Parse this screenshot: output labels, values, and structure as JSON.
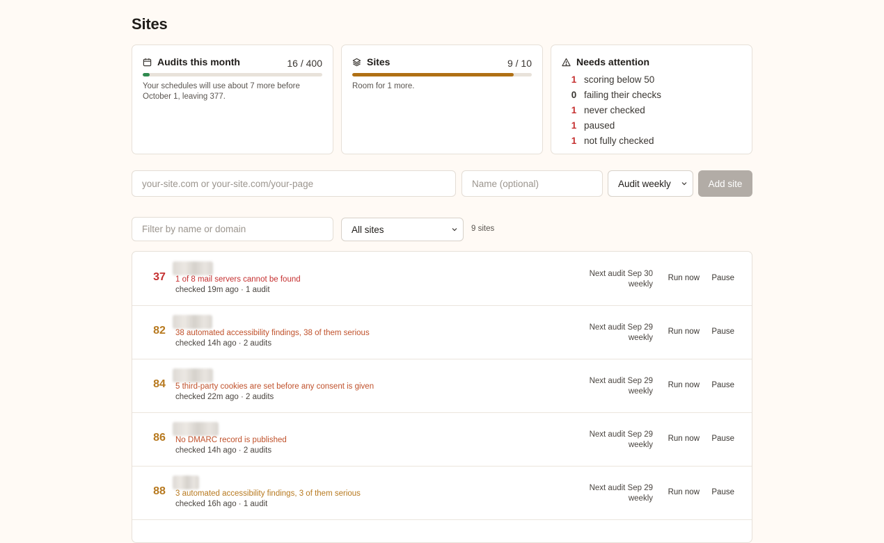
{
  "page": {
    "title": "Sites"
  },
  "cards": {
    "audits": {
      "icon": "calendar-icon",
      "title": "Audits this month",
      "count": "16 / 400",
      "fill": 0.04,
      "fill_color": "#2f8a4f",
      "note": "Your schedules will use about 7 more before October 1, leaving 377."
    },
    "sites": {
      "icon": "layers-icon",
      "title": "Sites",
      "count": "9 / 10",
      "fill": 0.9,
      "fill_color": "#b07014",
      "note": "Room for 1 more."
    },
    "attention": {
      "icon": "warning-icon",
      "title": "Needs attention",
      "items": [
        {
          "count": "1",
          "label": "scoring below 50"
        },
        {
          "count": "0",
          "label": "failing their checks"
        },
        {
          "count": "1",
          "label": "never checked"
        },
        {
          "count": "1",
          "label": "paused"
        },
        {
          "count": "1",
          "label": "not fully checked"
        }
      ]
    }
  },
  "add_form": {
    "url_placeholder": "your-site.com or your-site.com/your-page",
    "name_placeholder": "Name (optional)",
    "frequency": "Audit weekly",
    "button": "Add site"
  },
  "filter": {
    "placeholder": "Filter by name or domain",
    "scope": "All sites",
    "count": "9 sites"
  },
  "sites": [
    {
      "score": "37",
      "score_color": "#c53030",
      "finding": "1 of 8 mail servers cannot be found",
      "finding_color": "#c53030",
      "meta": "checked 19m ago · 1 audit",
      "next": "Next audit Sep 30",
      "freq": "weekly",
      "run": "Run now",
      "pause": "Pause"
    },
    {
      "score": "82",
      "score_color": "#b7791f",
      "finding": "38 automated accessibility findings, 38 of them serious",
      "finding_color": "#c0512b",
      "meta": "checked 14h ago · 2 audits",
      "next": "Next audit Sep 29",
      "freq": "weekly",
      "run": "Run now",
      "pause": "Pause"
    },
    {
      "score": "84",
      "score_color": "#b7791f",
      "finding": "5 third-party cookies are set before any consent is given",
      "finding_color": "#c0512b",
      "meta": "checked 22m ago · 2 audits",
      "next": "Next audit Sep 29",
      "freq": "weekly",
      "run": "Run now",
      "pause": "Pause"
    },
    {
      "score": "86",
      "score_color": "#b7791f",
      "finding": "No DMARC record is published",
      "finding_color": "#c0512b",
      "meta": "checked 14h ago · 2 audits",
      "next": "Next audit Sep 29",
      "freq": "weekly",
      "run": "Run now",
      "pause": "Pause"
    },
    {
      "score": "88",
      "score_color": "#b7791f",
      "finding": "3 automated accessibility findings, 3 of them serious",
      "finding_color": "#b7791f",
      "meta": "checked 16h ago · 1 audit",
      "next": "Next audit Sep 29",
      "freq": "weekly",
      "run": "Run now",
      "pause": "Pause"
    }
  ]
}
